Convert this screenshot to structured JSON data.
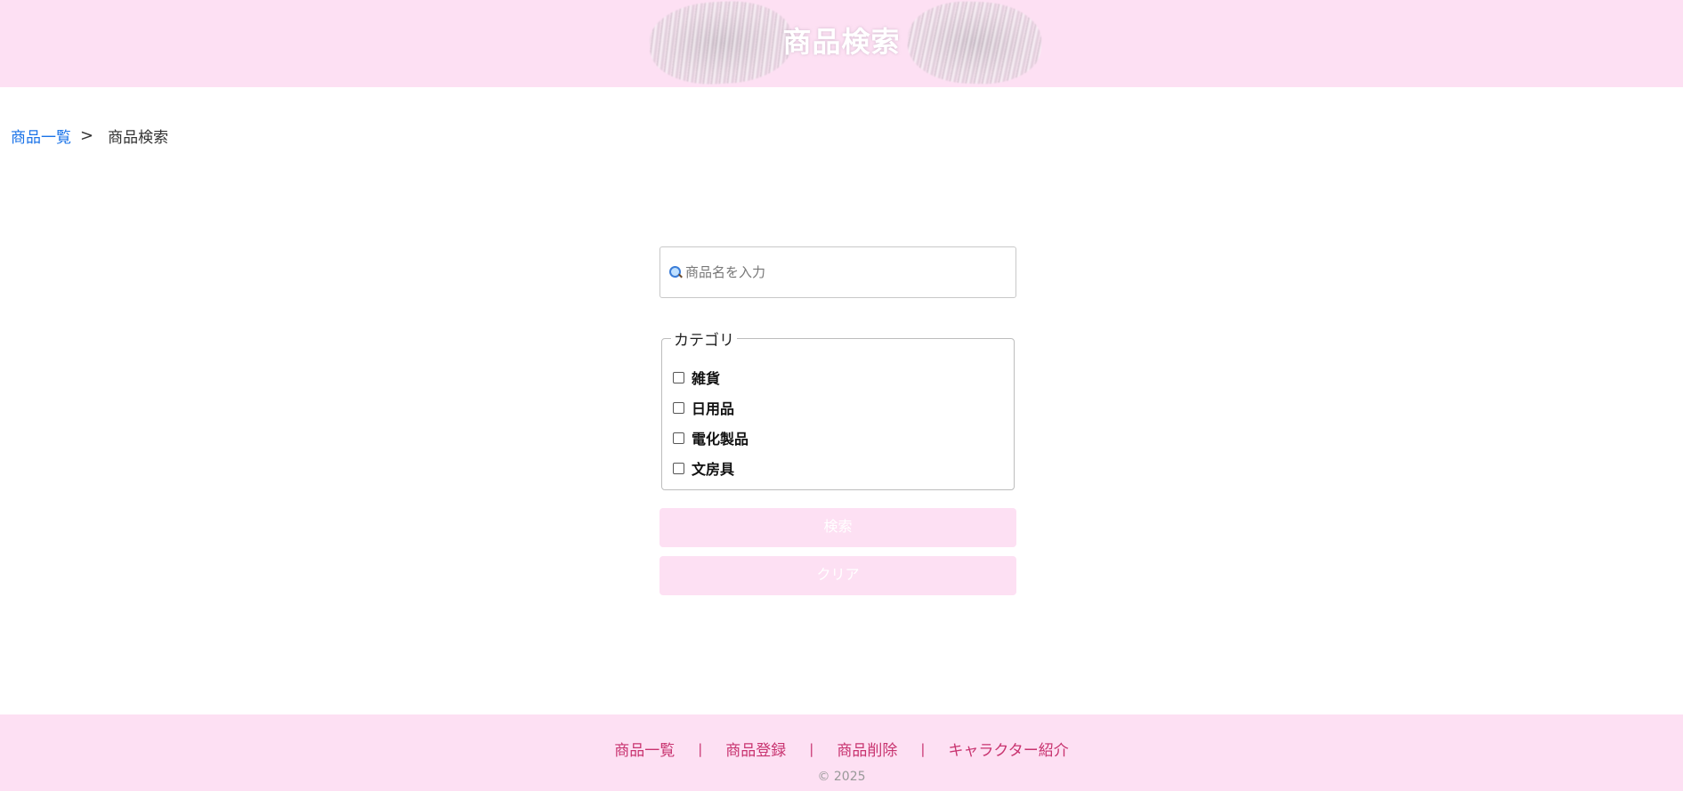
{
  "header": {
    "title": "商品検索"
  },
  "breadcrumb": {
    "items": [
      {
        "label": "商品一覧"
      },
      {
        "label": "商品検索"
      }
    ],
    "separator": ">"
  },
  "search": {
    "placeholder": "商品名を入力",
    "value": "",
    "icon": "magnifier-icon"
  },
  "category": {
    "legend": "カテゴリ",
    "options": [
      {
        "label": "雑貨",
        "checked": false
      },
      {
        "label": "日用品",
        "checked": false
      },
      {
        "label": "電化製品",
        "checked": false
      },
      {
        "label": "文房具",
        "checked": false
      }
    ]
  },
  "buttons": {
    "search_label": "検索",
    "clear_label": "クリア"
  },
  "footer": {
    "links": [
      {
        "label": "商品一覧"
      },
      {
        "label": "商品登録"
      },
      {
        "label": "商品削除"
      },
      {
        "label": "キャラクター紹介"
      }
    ],
    "divider": "|",
    "copyright": "© 2025"
  },
  "colors": {
    "header_bg": "#fde0f3",
    "link": "#1a73e8",
    "footer_link": "#c8336f",
    "button_bg": "#fde0f3"
  }
}
